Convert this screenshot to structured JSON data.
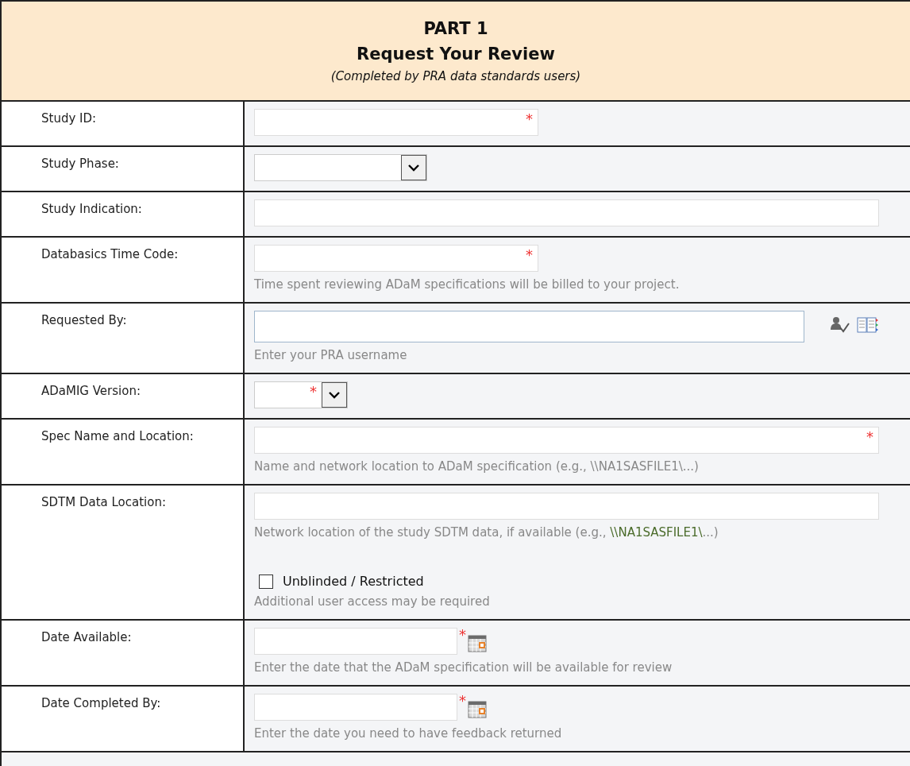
{
  "header": {
    "title": "PART 1",
    "subtitle": "Request Your Review",
    "note": "(Completed by PRA data standards users)"
  },
  "rows": [
    {
      "label": "Study ID:",
      "kind": "code",
      "required_mark": "*"
    },
    {
      "label": "Study Phase:",
      "kind": "select"
    },
    {
      "label": "Study Indication:",
      "kind": "text"
    },
    {
      "label": "Databasics Time Code:",
      "kind": "code",
      "required_mark": "*",
      "hint": "Time spent reviewing ADaM specifications will be billed to your project."
    },
    {
      "label": "Requested By:",
      "kind": "people",
      "hint": "Enter your PRA username"
    },
    {
      "label": "ADaMIG Version:",
      "kind": "version",
      "required_mark": "*"
    },
    {
      "label": "Spec Name and Location:",
      "kind": "text",
      "required_mark": "*",
      "hint": "Name and network location to ADaM specification (e.g., \\\\NA1SASFILE1\\...)"
    },
    {
      "label": "SDTM Data Location:",
      "kind": "text",
      "hint": "Network location of the study SDTM data, if available (e.g., ",
      "hint_link": "\\\\NA1SASFILE1\\",
      "hint_tail": "...)",
      "checkbox": {
        "label": "Unblinded / Restricted",
        "checked": false,
        "hint": "Additional user access may be required"
      }
    },
    {
      "label": "Date Available:",
      "kind": "date",
      "required_mark": "*",
      "hint": "Enter the date that the ADaM specification will be available for review"
    },
    {
      "label": "Date Completed By:",
      "kind": "date",
      "required_mark": "*",
      "hint": "Enter the date you need to have feedback returned"
    }
  ]
}
